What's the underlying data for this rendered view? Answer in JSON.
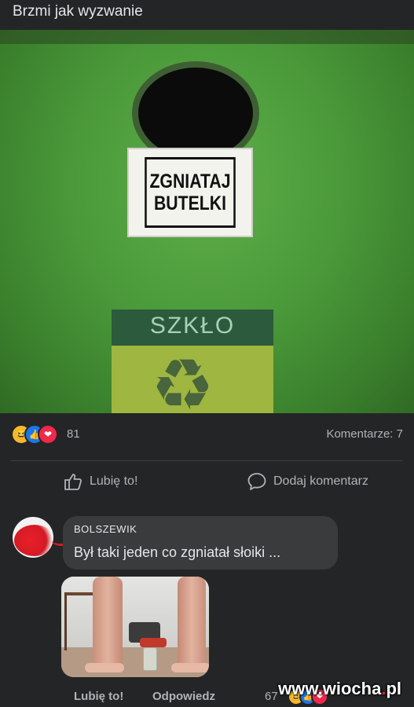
{
  "post": {
    "title": "Brzmi jak wyzwanie",
    "image": {
      "sticker_line1": "ZGNIATAJ",
      "sticker_line2": "BUTELKI",
      "label_word": "SZKŁO"
    }
  },
  "stats": {
    "reaction_icons": [
      "haha-icon",
      "like-icon",
      "love-icon"
    ],
    "reaction_count": "81",
    "comments_label": "Komentarze: 7"
  },
  "actions": {
    "like_label": "Lubię to!",
    "comment_label": "Dodaj komentarz"
  },
  "comment": {
    "author": "BOLSZEWIK",
    "text": "Był taki jeden co zgniatał słoiki ...",
    "like_label": "Lubię to!",
    "reply_label": "Odpowiedz",
    "reaction_count": "67"
  },
  "watermark": {
    "prefix": "www.",
    "name": "wiocha",
    "dot": ".",
    "suffix": "pl"
  },
  "colors": {
    "background": "#242526",
    "bubble": "#3a3b3c",
    "like_blue": "#1877f2",
    "love_red": "#f02849",
    "haha_yellow": "#f7b928"
  }
}
